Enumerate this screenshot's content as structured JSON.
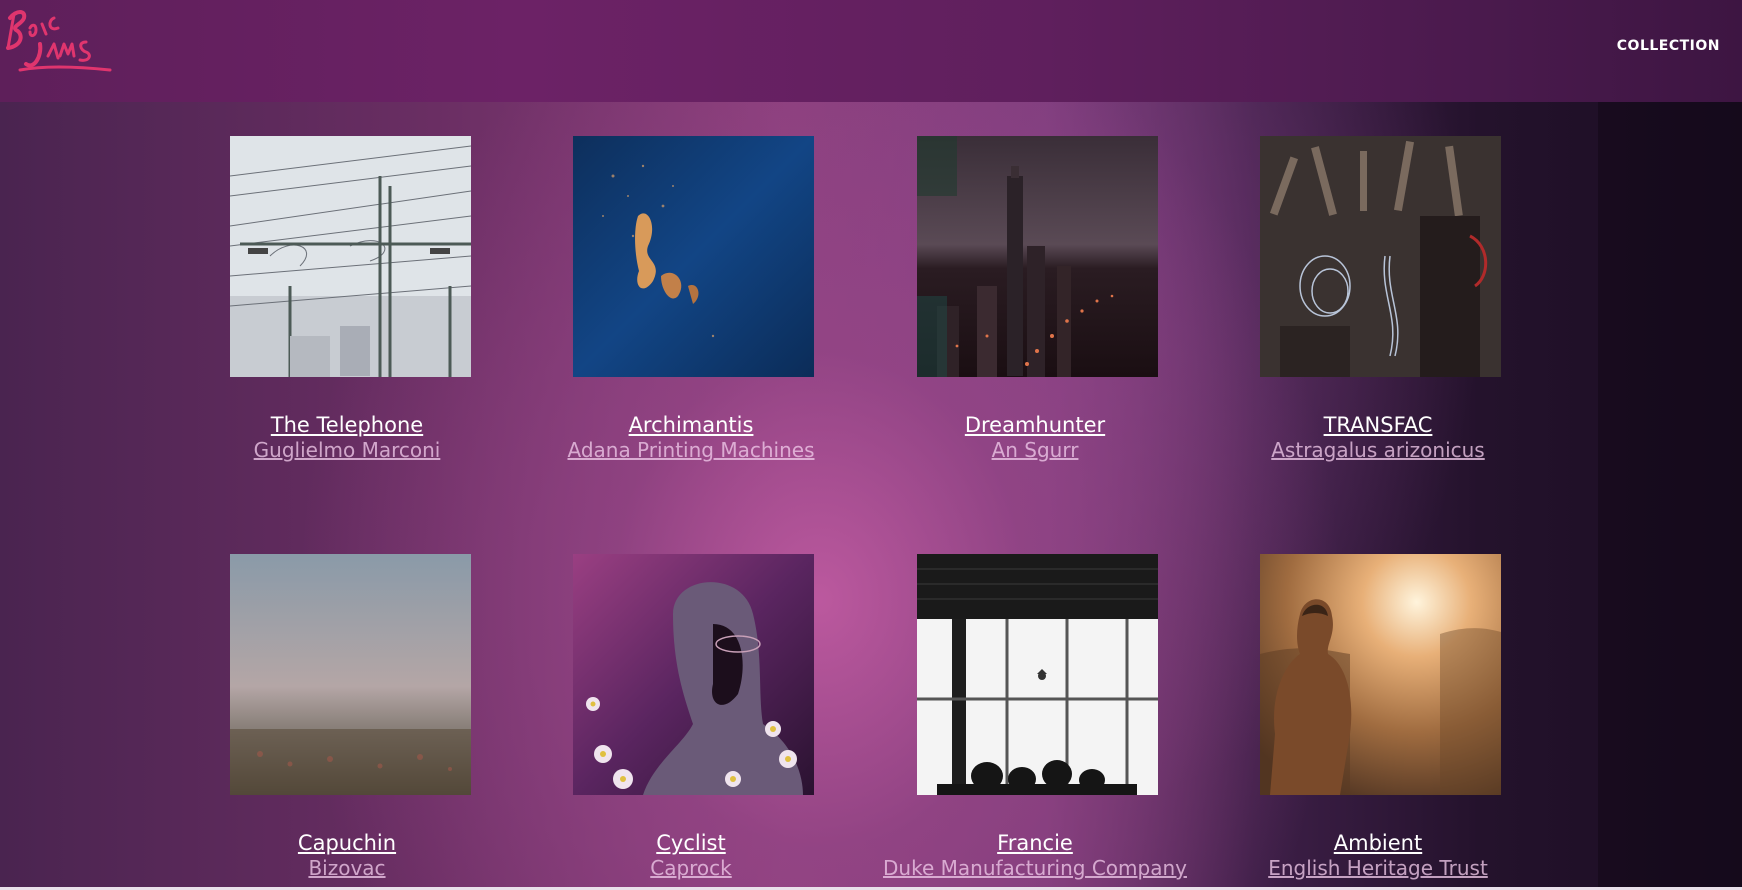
{
  "header": {
    "logo_text": "BIOC JAMS",
    "nav_collection": "COLLECTION"
  },
  "albums": [
    {
      "title": "The Telephone",
      "artist": "Guglielmo Marconi"
    },
    {
      "title": "Archimantis",
      "artist": "Adana Printing Machines"
    },
    {
      "title": "Dreamhunter",
      "artist": "An Sgurr"
    },
    {
      "title": "TRANSFAC",
      "artist": "Astragalus arizonicus"
    },
    {
      "title": "Capuchin",
      "artist": "Bizovac"
    },
    {
      "title": "Cyclist",
      "artist": "Caprock"
    },
    {
      "title": "Francie",
      "artist": "Duke Manufacturing Company"
    },
    {
      "title": "Ambient",
      "artist": "English Heritage Trust"
    }
  ],
  "colors": {
    "header_bg": "#651f60",
    "logo_accent": "#e0356e",
    "title_text": "#ffffff",
    "artist_text": "#d9b0d6"
  }
}
